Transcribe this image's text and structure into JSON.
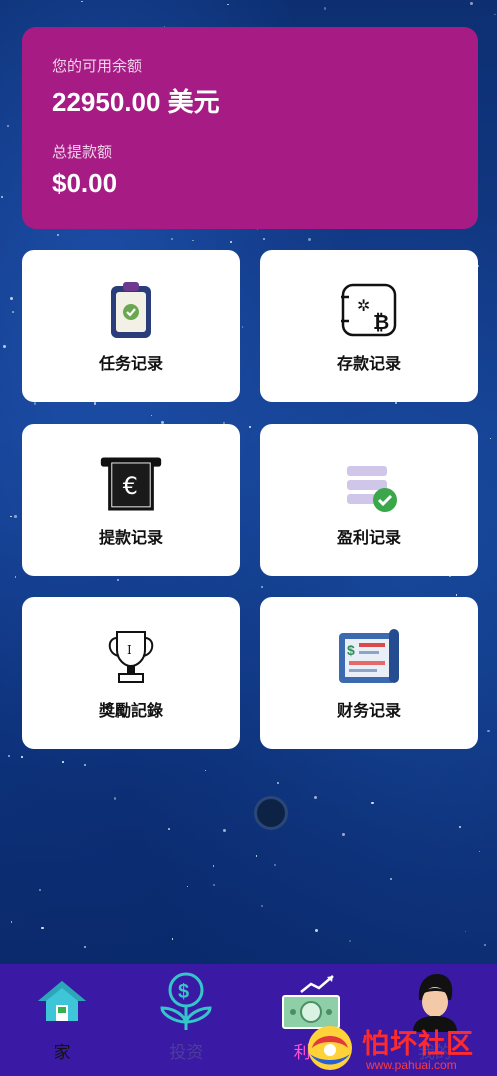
{
  "balance": {
    "available_label": "您的可用余额",
    "available_value": "22950.00 美元",
    "withdraw_label": "总提款额",
    "withdraw_value": "$0.00"
  },
  "tiles": [
    {
      "label": "任务记录",
      "icon": "clipboard-check-icon"
    },
    {
      "label": "存款记录",
      "icon": "bitcoin-exchange-icon"
    },
    {
      "label": "提款记录",
      "icon": "euro-atm-icon"
    },
    {
      "label": "盈利记录",
      "icon": "stack-check-icon"
    },
    {
      "label": "獎勵記錄",
      "icon": "trophy-icon"
    },
    {
      "label": "财务记录",
      "icon": "finance-report-icon"
    }
  ],
  "tabbar": {
    "items": [
      {
        "label": "家",
        "icon": "home-icon"
      },
      {
        "label": "投资",
        "icon": "money-plant-icon"
      },
      {
        "label": "利润",
        "icon": "profit-banknote-icon"
      },
      {
        "label": "我的",
        "icon": "avatar-icon"
      }
    ]
  },
  "watermark": {
    "text": "怕坏社区",
    "url": "www.pahuai.com"
  },
  "colors": {
    "card": "#a61c84",
    "tabbar": "#3a1aa5",
    "active_tab": "#ff4fd2"
  }
}
